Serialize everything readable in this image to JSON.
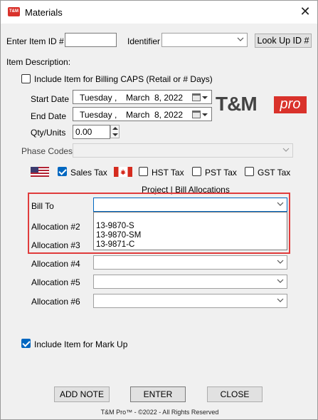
{
  "window": {
    "title": "Materials",
    "icon_text": "T&M",
    "close_glyph": "✕"
  },
  "top_row": {
    "item_id_label": "Enter Item ID #",
    "item_id_value": "",
    "identifier_label": "Identifier",
    "identifier_value": "",
    "lookup_button": "Look Up ID #"
  },
  "item_description_label": "Item Description:",
  "billing_caps": {
    "label": "Include Item for Billing CAPS (Retail or # Days)",
    "checked": false
  },
  "start_date": {
    "label": "Start Date",
    "weekday": "Tuesday",
    "sep": ",",
    "month": "March",
    "day_year": "8, 2022"
  },
  "end_date": {
    "label": "End Date",
    "weekday": "Tuesday",
    "sep": ",",
    "month": "March",
    "day_year": "8, 2022"
  },
  "qty": {
    "label": "Qty/Units",
    "value": "0.00"
  },
  "logo": {
    "main": "T&M",
    "accent": "pro",
    "accent_color": "#d9322b"
  },
  "phase_codes": {
    "label": "Phase Codes",
    "value": ""
  },
  "taxes": {
    "sales": {
      "label": "Sales Tax",
      "checked": true
    },
    "hst": {
      "label": "HST Tax",
      "checked": false
    },
    "pst": {
      "label": "PST Tax",
      "checked": false
    },
    "gst": {
      "label": "GST Tax",
      "checked": false
    }
  },
  "allocations": {
    "header": "Project | Bill Allocations",
    "bill_to": {
      "label": "Bill To",
      "value": ""
    },
    "dropdown_options": [
      "",
      "13-9870-S",
      "13-9870-SM",
      "13-9871-C"
    ],
    "rows": [
      {
        "label": "Allocation #2"
      },
      {
        "label": "Allocation #3"
      },
      {
        "label": "Allocation #4"
      },
      {
        "label": "Allocation #5"
      },
      {
        "label": "Allocation #6"
      }
    ]
  },
  "markup": {
    "label": "Include Item for Mark Up",
    "checked": true
  },
  "buttons": {
    "add_note": "ADD NOTE",
    "enter": "ENTER",
    "close": "CLOSE"
  },
  "footer": "T&M Pro™ - ©2022 - All Rights Reserved",
  "colors": {
    "accent": "#0067c0",
    "highlight": "#e03c3c"
  }
}
